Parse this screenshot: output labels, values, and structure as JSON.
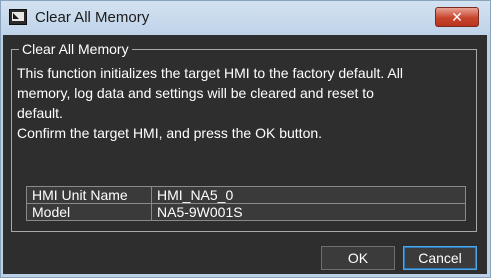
{
  "window": {
    "title": "Clear All Memory",
    "close_symbol": "✕",
    "app_icon": "hmi-app-icon"
  },
  "group": {
    "label": "Clear All Memory",
    "description_lines": [
      "This function initializes the target HMI to the factory default. All",
      "memory, log data and settings will be cleared and reset to",
      "default.",
      "Confirm the target HMI, and press the OK button."
    ],
    "table": [
      {
        "key": "HMI Unit Name",
        "value": "HMI_NA5_0"
      },
      {
        "key": "Model",
        "value": "NA5-9W001S"
      }
    ]
  },
  "buttons": {
    "ok_label": "OK",
    "cancel_label": "Cancel"
  },
  "colors": {
    "titlebar": "#c9dbee",
    "content_bg": "#2e2e2e",
    "close_button": "#c7452d",
    "focus_border": "#4fa7e5"
  }
}
